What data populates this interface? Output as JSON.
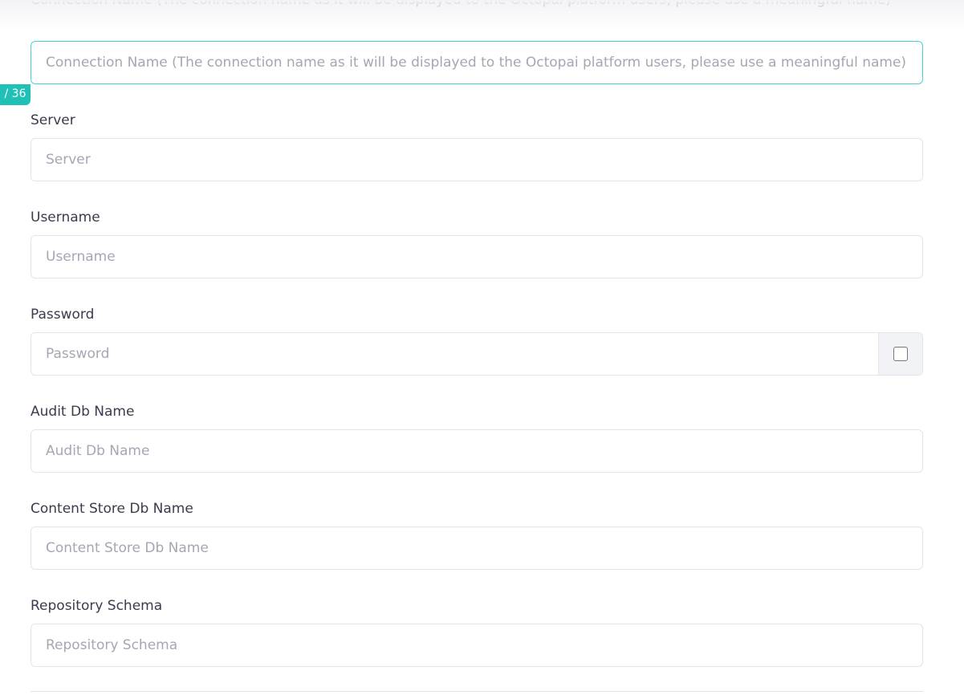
{
  "badge": "/ 36",
  "fields": [
    {
      "label": "Connection Name (The connection name as it will be displayed to the Octopai platform users, please use a meaningful name)",
      "placeholder": "Connection Name (The connection name as it will be displayed to the Octopai platform users, please use a meaningful name)"
    },
    {
      "label": "Server",
      "placeholder": "Server"
    },
    {
      "label": "Username",
      "placeholder": "Username"
    },
    {
      "label": "Password",
      "placeholder": "Password"
    },
    {
      "label": "Audit Db Name",
      "placeholder": "Audit Db Name"
    },
    {
      "label": "Content Store Db Name",
      "placeholder": "Content Store Db Name"
    },
    {
      "label": "Repository Schema",
      "placeholder": "Repository Schema"
    }
  ]
}
